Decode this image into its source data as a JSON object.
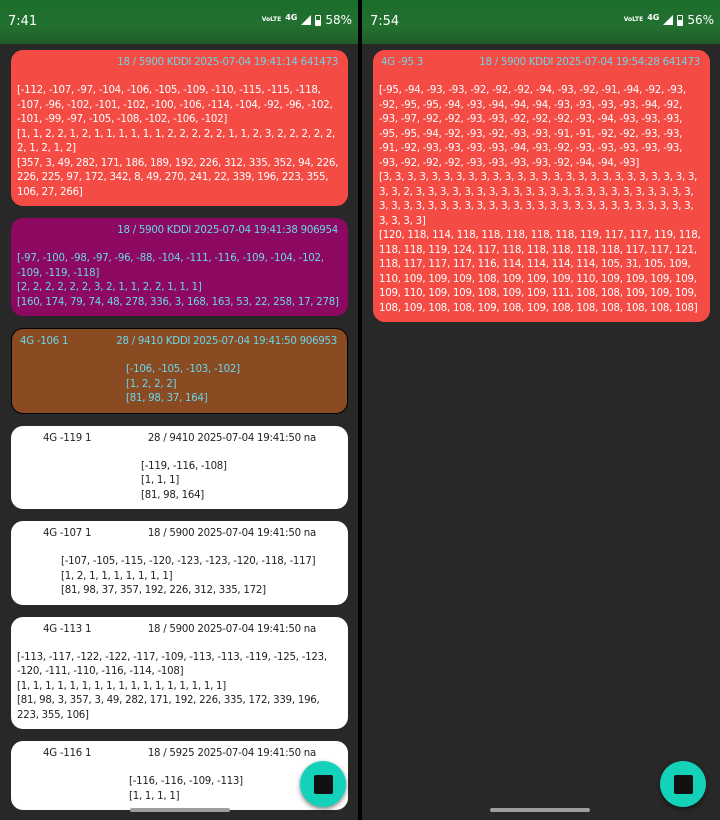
{
  "left": {
    "status": {
      "time": "7:41",
      "volte": "VoLTE",
      "network": "4G",
      "battery": "58%"
    },
    "cards": [
      {
        "style": "red",
        "net": "",
        "info": "18 / 5900 KDDI 2025-07-04 19:41:14 641473",
        "rsrp": "[-112, -107, -97, -104, -106, -105, -109, -110, -115, -115, -118, -107, -96, -102, -101, -102, -100, -106, -114, -104, -92, -96, -102, -101, -99, -97, -105, -108, -102, -106, -102]",
        "cnt": "[1, 1, 2, 2, 1, 2, 1, 1, 1, 1, 1, 1, 2, 2, 2, 2, 2, 1, 1, 2, 3, 2, 2, 2, 2, 2, 2, 1, 2, 1, 2]",
        "pci": "[357, 3, 49, 282, 171, 186, 189, 192, 226, 312, 335, 352, 94, 226, 226, 225, 97, 172, 342, 8, 49, 270, 241, 22, 339, 196, 223, 355, 106, 27, 266]",
        "indent": 0
      },
      {
        "style": "purple",
        "net": "",
        "info": "18 / 5900 KDDI 2025-07-04 19:41:38 906954",
        "rsrp": "[-97, -100, -98, -97, -96, -88, -104, -111, -116, -109, -104, -102, -109, -119, -118]",
        "cnt": "[2, 2, 2, 2, 2, 2, 3, 2, 1, 1, 2, 2, 1, 1, 1]",
        "pci": "[160, 174, 79, 74, 48, 278, 336, 3, 168, 163, 53, 22, 258, 17, 278]",
        "indent": 0
      },
      {
        "style": "brown",
        "net": "4G -106 1",
        "info": "28 / 9410 KDDI 2025-07-04 19:41:50 906953",
        "rsrp": "[-106, -105, -103, -102]",
        "cnt": "[1, 2, 2, 2]",
        "pci": "[81, 98, 37, 164]",
        "indent": 108
      },
      {
        "style": "white",
        "net": "4G -119 1",
        "info": "28 / 9410  2025-07-04 19:41:50 na",
        "rsrp": "[-119, -116, -108]",
        "cnt": "[1, 1, 1]",
        "pci": "[81, 98, 164]",
        "indent": 124
      },
      {
        "style": "white",
        "net": "4G -107 1",
        "info": "18 / 5900  2025-07-04 19:41:50 na",
        "rsrp": "[-107, -105, -115, -120, -123, -123, -120, -118, -117]",
        "cnt": "[1, 2, 1, 1, 1, 1, 1, 1, 1]",
        "pci": "[81, 98, 37, 357, 192, 226, 312, 335, 172]",
        "indent": 44
      },
      {
        "style": "white",
        "net": "4G -113 1",
        "info": "18 / 5900  2025-07-04 19:41:50 na",
        "rsrp": "[-113, -117, -122, -122, -117, -109, -113, -113, -119, -125, -123, -120, -111, -110, -116, -114, -108]",
        "cnt": "[1, 1, 1, 1, 1, 1, 1, 1, 1, 1, 1, 1, 1, 1, 1, 1, 1]",
        "pci": "[81, 98, 3, 357, 3, 49, 282, 171, 192, 226, 335, 172, 339, 196, 223, 355, 106]",
        "indent": 0
      },
      {
        "style": "white",
        "net": "4G -116 1",
        "info": "18 / 5925  2025-07-04 19:41:50 na",
        "rsrp": "[-116, -116, -109, -113]",
        "cnt": "[1, 1, 1, 1]",
        "pci": "",
        "indent": 112
      }
    ]
  },
  "right": {
    "status": {
      "time": "7:54",
      "volte": "VoLTE",
      "network": "4G",
      "battery": "56%"
    },
    "cards": [
      {
        "style": "red",
        "net": "4G -95 3",
        "info": "18 / 5900 KDDI 2025-07-04 19:54:28 641473",
        "rsrp": "[-95, -94, -93, -93, -92, -92, -92, -94, -93, -92, -91, -94, -92, -93, -92, -95, -95, -94, -93, -94, -94, -94, -93, -93, -93, -93, -94, -92, -93, -97, -92, -92, -93, -93, -92, -92, -92, -93, -94, -93, -93, -93, -95, -95, -94, -92, -93, -92, -93, -93, -91, -91, -92, -92, -93, -93, -91, -92, -93, -93, -93, -93, -94, -93, -92, -93, -93, -93, -93, -93, -93, -92, -92, -92, -93, -93, -93, -93, -92, -94, -94, -93]",
        "cnt": "[3, 3, 3, 3, 3, 3, 3, 3, 3, 3, 3, 3, 3, 3, 3, 3, 3, 3, 3, 3, 3, 3, 3, 3, 3, 3, 3, 3, 2, 3, 3, 3, 3, 3, 3, 3, 3, 3, 3, 3, 3, 3, 3, 3, 3, 3, 3, 3, 3, 3, 3, 3, 3, 3, 3, 3, 3, 3, 3, 3, 3, 3, 3, 3, 3, 3, 3, 3, 3, 3, 3, 3, 3, 3, 3, 3, 3, 3, 3, 3, 3, 3]",
        "pci": "[120, 118, 114, 118, 118, 118, 118, 118, 119, 117, 117, 119, 118, 118, 118, 119, 124, 117, 118, 118, 118, 118, 118, 117, 117, 121, 118, 117, 117, 117, 116, 114, 114, 114, 114, 105, 31, 105, 109, 110, 109, 109, 109, 108, 109, 109, 109, 110, 109, 109, 109, 109, 109, 110, 109, 109, 108, 109, 109, 111, 108, 108, 109, 109, 109, 108, 109, 108, 108, 109, 108, 109, 108, 108, 108, 108, 108, 108]",
        "indent": 0
      }
    ]
  }
}
